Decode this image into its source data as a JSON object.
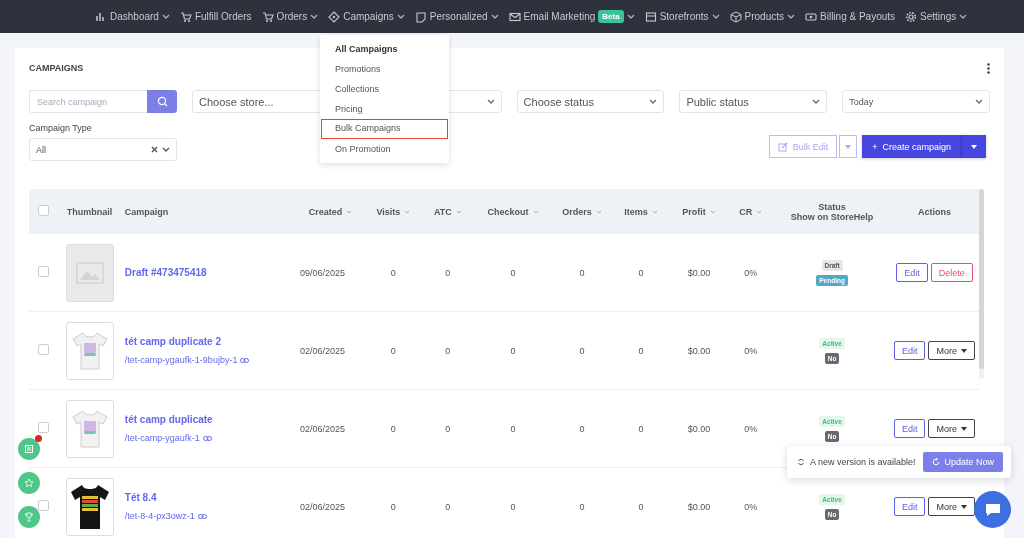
{
  "nav": {
    "items": [
      {
        "label": "Dashboard",
        "has_menu": true
      },
      {
        "label": "Fulfill Orders",
        "has_menu": false
      },
      {
        "label": "Orders",
        "has_menu": true
      },
      {
        "label": "Campaigns",
        "has_menu": true
      },
      {
        "label": "Personalized",
        "has_menu": true
      },
      {
        "label": "Email Marketing",
        "has_menu": true,
        "badge": "Beta"
      },
      {
        "label": "Storefronts",
        "has_menu": true
      },
      {
        "label": "Products",
        "has_menu": true
      },
      {
        "label": "Billing & Payouts",
        "has_menu": false
      },
      {
        "label": "Settings",
        "has_menu": true
      }
    ]
  },
  "campaigns_menu": {
    "items": [
      {
        "label": "All Campaigns",
        "selected": true,
        "hovered": false
      },
      {
        "label": "Promotions",
        "selected": false,
        "hovered": false
      },
      {
        "label": "Collections",
        "selected": false,
        "hovered": false
      },
      {
        "label": "Pricing",
        "selected": false,
        "hovered": false
      },
      {
        "label": "Bulk Campaigns",
        "selected": false,
        "hovered": true
      },
      {
        "label": "On Promotion",
        "selected": false,
        "hovered": false
      }
    ]
  },
  "page": {
    "title": "CAMPAIGNS",
    "search": {
      "placeholder": "Search campaign"
    },
    "filters": [
      {
        "value": "Choose store..."
      },
      {
        "value": "Choose status"
      },
      {
        "value": "Public status"
      },
      {
        "value": "Today"
      }
    ],
    "campaign_type": {
      "label": "Campaign Type",
      "value": "All"
    },
    "bulk_edit": {
      "label": "Bulk Edit",
      "disabled": true
    },
    "create": {
      "label": "Create campaign",
      "icon": "+"
    }
  },
  "table": {
    "all_checked": false,
    "columns": [
      {
        "label": "Thumbnail",
        "sortable": false
      },
      {
        "label": "Campaign",
        "sortable": false
      },
      {
        "label": "Created",
        "sortable": true
      },
      {
        "label": "Visits",
        "sortable": true
      },
      {
        "label": "ATC",
        "sortable": true
      },
      {
        "label": "Checkout",
        "sortable": true
      },
      {
        "label": "Orders",
        "sortable": true
      },
      {
        "label": "Items",
        "sortable": true
      },
      {
        "label": "Profit",
        "sortable": true
      },
      {
        "label": "CR",
        "sortable": true
      },
      {
        "label": "Status",
        "sortable": false,
        "sublabel": "Show on StoreHelp"
      },
      {
        "label": "Actions",
        "sortable": false
      }
    ],
    "rows": [
      {
        "checked": false,
        "thumbnail": {
          "kind": "placeholder"
        },
        "name": "Draft #473475418",
        "created": "09/06/2025",
        "visits": "0",
        "atc": "0",
        "checkout": "0",
        "orders": "0",
        "items": "0",
        "profit": "$0.00",
        "cr": "0%",
        "status": {
          "label": "Draft",
          "kind": "draft"
        },
        "storehelp": {
          "label": "Pending",
          "kind": "pending"
        },
        "actions": [
          {
            "label": "Edit",
            "kind": "edit"
          },
          {
            "label": "Delete",
            "kind": "delete"
          }
        ]
      },
      {
        "checked": false,
        "thumbnail": {
          "kind": "white-shirt"
        },
        "name": "tét camp duplicate 2",
        "slug": "/tet-camp-ygaufk-1-9bujby-1",
        "created": "02/06/2025",
        "visits": "0",
        "atc": "0",
        "checkout": "0",
        "orders": "0",
        "items": "0",
        "profit": "$0.00",
        "cr": "0%",
        "status": {
          "label": "Active",
          "kind": "active"
        },
        "storehelp": {
          "label": "No",
          "kind": "no"
        },
        "actions": [
          {
            "label": "Edit",
            "kind": "edit"
          },
          {
            "label": "More",
            "kind": "more"
          }
        ]
      },
      {
        "checked": false,
        "thumbnail": {
          "kind": "white-shirt"
        },
        "name": "tét camp duplicate",
        "slug": "/tet-camp-ygaufk-1",
        "created": "02/06/2025",
        "visits": "0",
        "atc": "0",
        "checkout": "0",
        "orders": "0",
        "items": "0",
        "profit": "$0.00",
        "cr": "0%",
        "status": {
          "label": "Active",
          "kind": "active"
        },
        "storehelp": {
          "label": "No",
          "kind": "no"
        },
        "actions": [
          {
            "label": "Edit",
            "kind": "edit"
          },
          {
            "label": "More",
            "kind": "more"
          }
        ]
      },
      {
        "checked": false,
        "thumbnail": {
          "kind": "black-shirt"
        },
        "name": "Tét 8.4",
        "slug": "/tet-8-4-px3owz-1",
        "created": "02/06/2025",
        "visits": "0",
        "atc": "0",
        "checkout": "0",
        "orders": "0",
        "items": "0",
        "profit": "$0.00",
        "cr": "0%",
        "status": {
          "label": "Active",
          "kind": "active"
        },
        "storehelp": {
          "label": "No",
          "kind": "no"
        },
        "actions": [
          {
            "label": "Edit",
            "kind": "edit"
          },
          {
            "label": "More",
            "kind": "more"
          }
        ]
      }
    ]
  },
  "floating_buttons": [
    {
      "notification": true
    },
    {
      "notification": false
    },
    {
      "notification": false
    }
  ],
  "toast": {
    "message": "A new version is available!",
    "button": "Update Now"
  }
}
